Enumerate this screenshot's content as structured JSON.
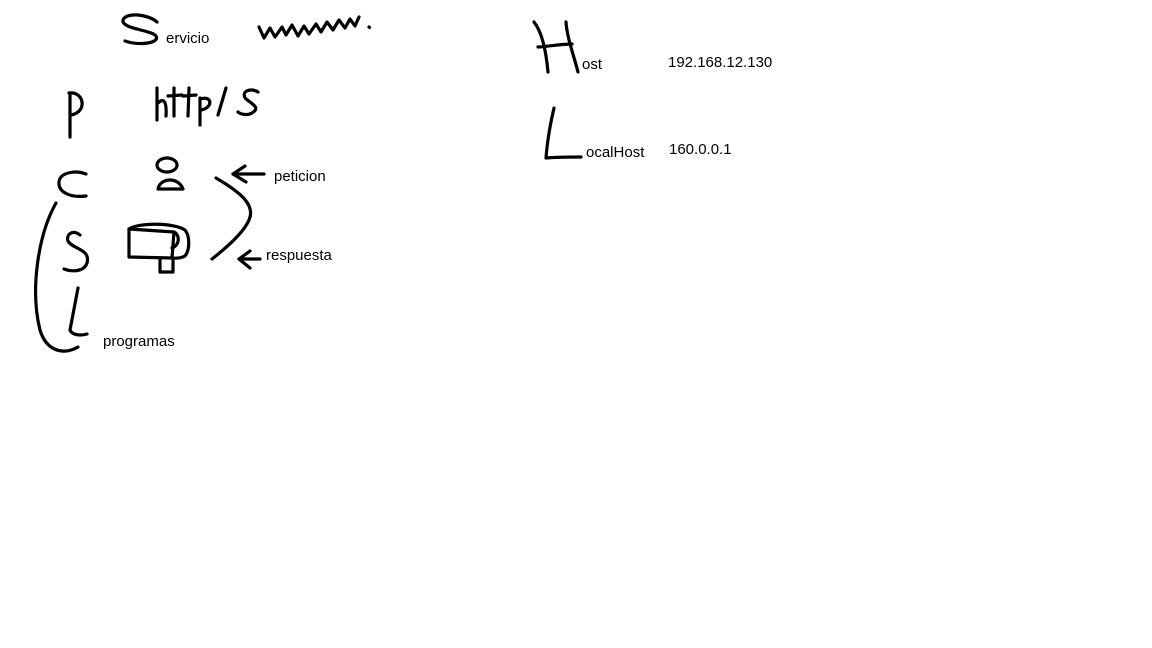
{
  "labels": {
    "servicio_suffix": "ervicio",
    "host_suffix": "ost",
    "host_ip": "192.168.12.130",
    "localhost_suffix": "ocalHost",
    "localhost_ip": "160.0.0.1",
    "peticion": "peticion",
    "respuesta": "respuesta",
    "programas": "programas"
  },
  "icons": {
    "user": "user-icon",
    "server": "server-icon"
  },
  "colors": {
    "background": "#ffffff",
    "ink": "#000000"
  }
}
